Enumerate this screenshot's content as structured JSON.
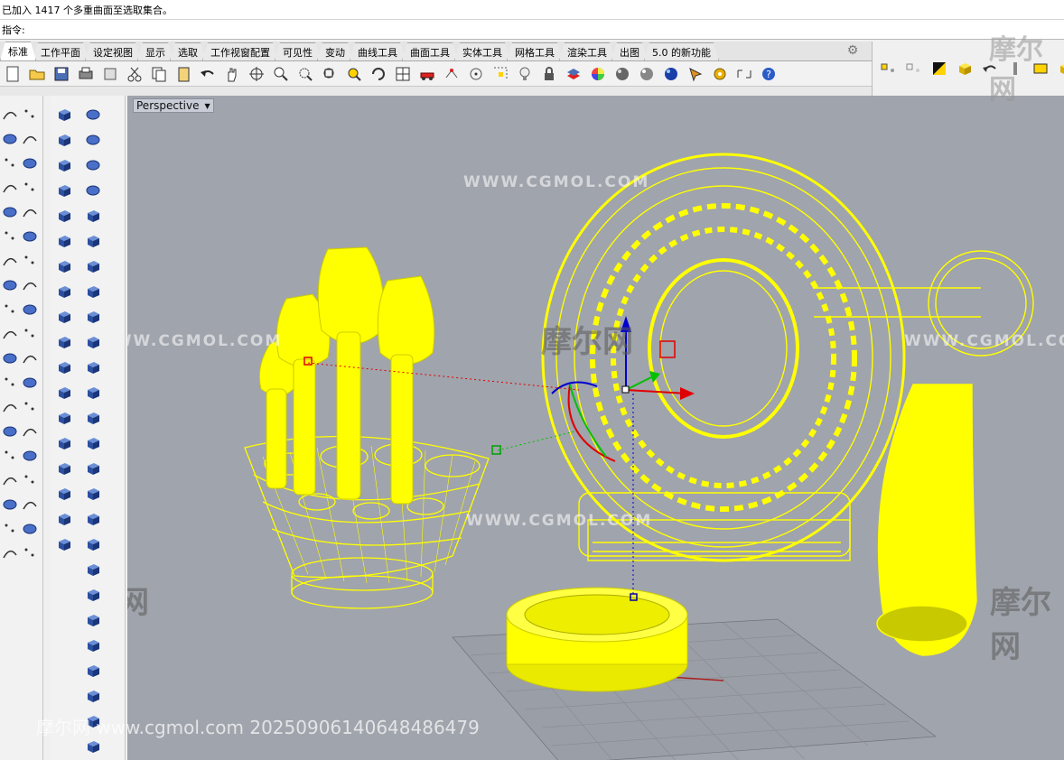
{
  "command": {
    "history_text": "已加入 1417 个多重曲面至选取集合。",
    "prompt_label": "指令:",
    "input_value": ""
  },
  "tabs": [
    {
      "label": "标准",
      "active": true
    },
    {
      "label": "工作平面",
      "active": false
    },
    {
      "label": "设定视图",
      "active": false
    },
    {
      "label": "显示",
      "active": false
    },
    {
      "label": "选取",
      "active": false
    },
    {
      "label": "工作视窗配置",
      "active": false
    },
    {
      "label": "可见性",
      "active": false
    },
    {
      "label": "变动",
      "active": false
    },
    {
      "label": "曲线工具",
      "active": false
    },
    {
      "label": "曲面工具",
      "active": false
    },
    {
      "label": "实体工具",
      "active": false
    },
    {
      "label": "网格工具",
      "active": false
    },
    {
      "label": "渲染工具",
      "active": false
    },
    {
      "label": "出图",
      "active": false
    },
    {
      "label": "5.0 的新功能",
      "active": false
    }
  ],
  "toolbar_icons": [
    "new-icon",
    "open-icon",
    "save-icon",
    "print-icon",
    "import-icon",
    "cut-icon",
    "copy-icon",
    "paste-icon",
    "undo-icon",
    "pan-hand-icon",
    "rotate-view-icon",
    "zoom-icon",
    "zoom-window-icon",
    "zoom-extents-icon",
    "zoom-selected-icon",
    "refresh-view-icon",
    "four-view-icon",
    "car-icon",
    "select-points-icon",
    "circle-tool-icon",
    "grid-snap-icon",
    "light-bulb-icon",
    "lock-icon",
    "layer-icon",
    "color-wheel-icon",
    "material-sphere-icon",
    "render-sphere-icon",
    "render-blue-icon",
    "paint-icon",
    "settings-gear-icon",
    "dimension-icon",
    "help-icon"
  ],
  "viewport": {
    "title": "Perspective",
    "dropdown_arrow": "▼"
  },
  "watermarks": {
    "latin": "WWW.CGMOL.COM",
    "cn": "摩尔网",
    "footer": "摩尔网 www.cgmol.com 20250906140648486479"
  },
  "colors": {
    "wire": "#ffff00",
    "viewport_bg": "#a0a4ac",
    "gumball_x": "#e00000",
    "gumball_y": "#00c000",
    "gumball_z": "#0000d0"
  }
}
